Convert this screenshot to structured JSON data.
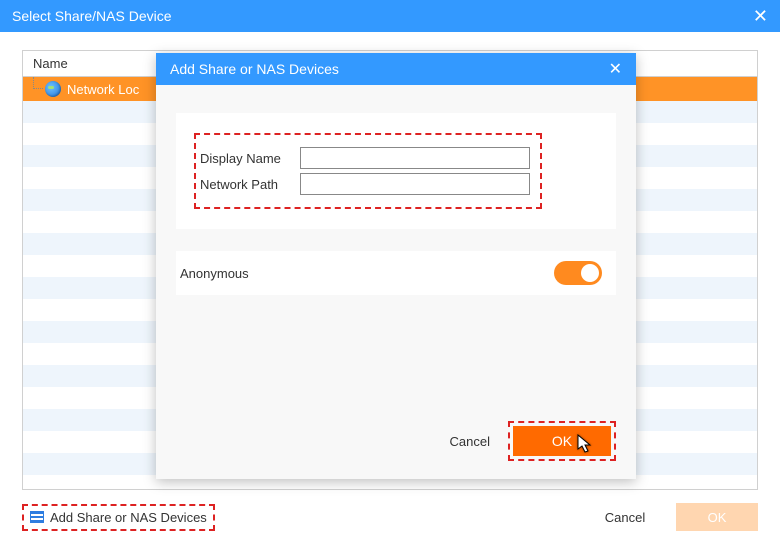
{
  "outer": {
    "title": "Select Share/NAS Device",
    "column_header": "Name",
    "tree_item": "Network Loc",
    "add_link": "Add Share or NAS Devices",
    "cancel": "Cancel",
    "ok": "OK"
  },
  "modal": {
    "title": "Add Share or NAS Devices",
    "display_name_label": "Display Name",
    "display_name_value": "",
    "network_path_label": "Network Path",
    "network_path_value": "",
    "anonymous_label": "Anonymous",
    "anonymous_on": true,
    "cancel": "Cancel",
    "ok": "OK"
  }
}
